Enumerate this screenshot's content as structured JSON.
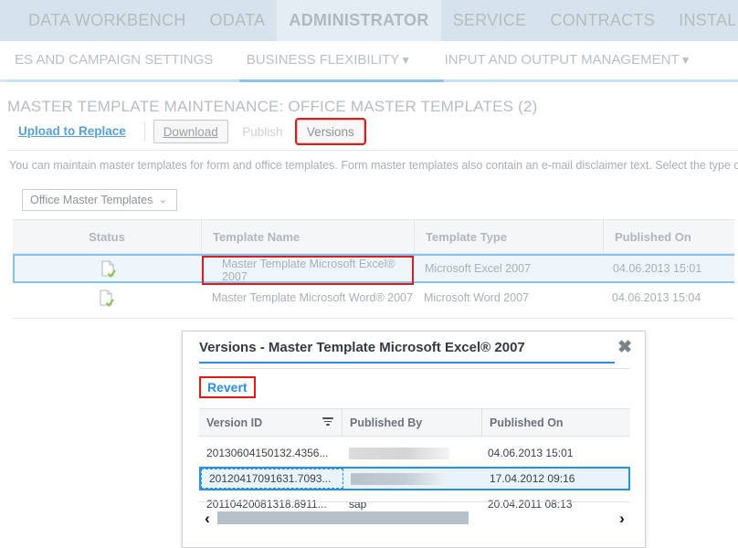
{
  "topnav": {
    "items": [
      {
        "label": "DATA WORKBENCH",
        "active": false
      },
      {
        "label": "ODATA",
        "active": false
      },
      {
        "label": "ADMINISTRATOR",
        "active": true
      },
      {
        "label": "SERVICE",
        "active": false
      },
      {
        "label": "CONTRACTS",
        "active": false
      },
      {
        "label": "INSTALLE",
        "active": false
      }
    ]
  },
  "subnav": {
    "items": [
      {
        "label": "ES AND CAMPAIGN SETTINGS",
        "caret": "",
        "active": false
      },
      {
        "label": "BUSINESS FLEXIBILITY",
        "caret": "▼",
        "active": true
      },
      {
        "label": "INPUT AND OUTPUT MANAGEMENT",
        "caret": "▼",
        "active": false
      }
    ]
  },
  "page": {
    "title": "MASTER TEMPLATE MAINTENANCE: OFFICE MASTER TEMPLATES (2)",
    "description": "You can maintain master templates for form and office templates. Form master templates also contain an e-mail disclaimer text. Select the type of ma"
  },
  "toolbar": {
    "upload_label": "Upload to Replace",
    "download_label": "Download",
    "publish_label": "Publish",
    "versions_label": "Versions"
  },
  "filter": {
    "selected": "Office Master Templates",
    "chevron": "⌄"
  },
  "main_table": {
    "columns": [
      "Status",
      "Template Name",
      "Template Type",
      "Published On"
    ],
    "rows": [
      {
        "status_icon": "document-check-icon",
        "name": "Master Template Microsoft Excel® 2007",
        "type": "Microsoft Excel 2007",
        "published_on": "04.06.2013 15:01",
        "selected": true,
        "name_highlighted": true
      },
      {
        "status_icon": "document-check-icon",
        "name": "Master Template Microsoft Word® 2007",
        "type": "Microsoft Word 2007",
        "published_on": "04.06.2013 15:04",
        "selected": false,
        "name_highlighted": false
      }
    ]
  },
  "dialog": {
    "title": "Versions - Master Template Microsoft Excel® 2007",
    "close_label": "✖",
    "revert_label": "Revert",
    "columns": [
      "Version ID",
      "Published By",
      "Published On"
    ],
    "rows": [
      {
        "version_id": "20130604150132.4356...",
        "published_by": "",
        "published_by_redacted": true,
        "published_on": "04.06.2013 15:01",
        "selected": false
      },
      {
        "version_id": "20120417091631.7093...",
        "published_by": "",
        "published_by_redacted": true,
        "published_on": "17.04.2012 09:16",
        "selected": true
      },
      {
        "version_id": "20110420081318.8911...",
        "published_by": "sap",
        "published_by_redacted": false,
        "published_on": "20.04.2011 08:13",
        "selected": false
      }
    ],
    "scroll_left_label": "‹",
    "scroll_right_label": "›"
  },
  "colors": {
    "topnav_bg": "#d6e2ec",
    "accent_blue": "#2a8fe0",
    "highlight_red": "#e01b1b",
    "selected_row": "#eef5fb",
    "status_green": "#8cc152"
  }
}
